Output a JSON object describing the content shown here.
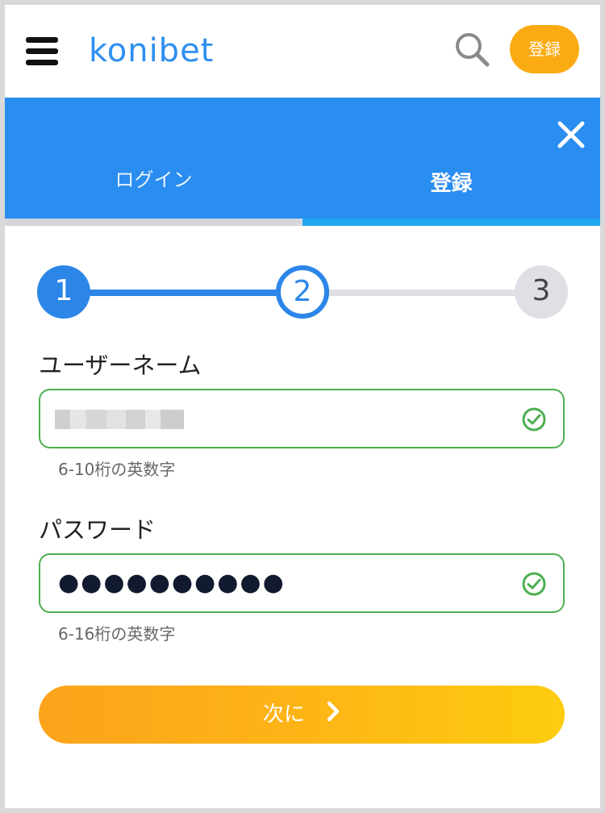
{
  "header": {
    "logo_text": "konibet",
    "register_label": "登録",
    "icons": {
      "menu": "hamburger-menu-icon",
      "search": "search-icon"
    }
  },
  "tabs": {
    "login_label": "ログイン",
    "register_label": "登録",
    "active": "register",
    "close_icon": "close-icon"
  },
  "stepper": {
    "steps": [
      "1",
      "2",
      "3"
    ],
    "current_step": 2
  },
  "form": {
    "username": {
      "label": "ユーザーネーム",
      "value_masked": true,
      "hint": "6-10桁の英数字",
      "valid": true
    },
    "password": {
      "label": "パスワード",
      "value": "●●●●●●●●●●",
      "hint": "6-16桁の英数字",
      "valid": true
    }
  },
  "next_button": {
    "label": "次に"
  },
  "colors": {
    "primary_blue": "#2a8df0",
    "accent_orange": "#fbab12",
    "valid_green": "#4caf50"
  }
}
